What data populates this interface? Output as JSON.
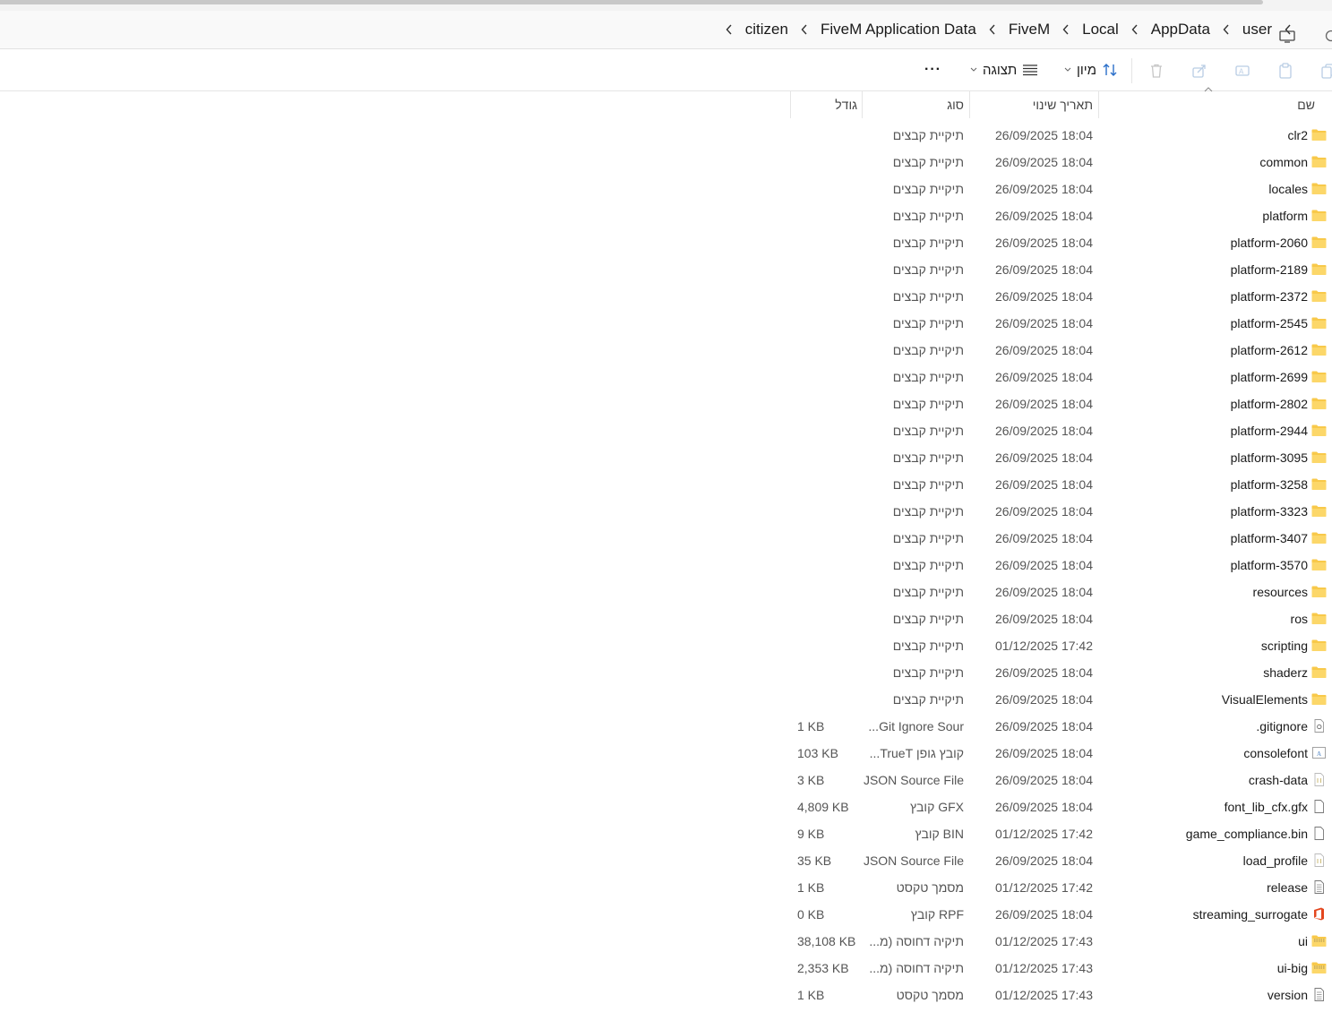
{
  "breadcrumb": [
    "user",
    "AppData",
    "Local",
    "FiveM",
    "FiveM Application Data",
    "citizen"
  ],
  "toolbar": {
    "sort_label": "מיון",
    "view_label": "תצוגה",
    "more_label": "···"
  },
  "columns": {
    "name": "שם",
    "date": "תאריך שינוי",
    "type": "סוג",
    "size": "גודל"
  },
  "files": [
    {
      "name": "clr2",
      "date": "26/09/2025 18:04",
      "type": "תיקיית קבצים",
      "size": "",
      "icon": "folder-icon"
    },
    {
      "name": "common",
      "date": "26/09/2025 18:04",
      "type": "תיקיית קבצים",
      "size": "",
      "icon": "folder-icon"
    },
    {
      "name": "locales",
      "date": "26/09/2025 18:04",
      "type": "תיקיית קבצים",
      "size": "",
      "icon": "folder-icon"
    },
    {
      "name": "platform",
      "date": "26/09/2025 18:04",
      "type": "תיקיית קבצים",
      "size": "",
      "icon": "folder-icon"
    },
    {
      "name": "platform-2060",
      "date": "26/09/2025 18:04",
      "type": "תיקיית קבצים",
      "size": "",
      "icon": "folder-icon"
    },
    {
      "name": "platform-2189",
      "date": "26/09/2025 18:04",
      "type": "תיקיית קבצים",
      "size": "",
      "icon": "folder-icon"
    },
    {
      "name": "platform-2372",
      "date": "26/09/2025 18:04",
      "type": "תיקיית קבצים",
      "size": "",
      "icon": "folder-icon"
    },
    {
      "name": "platform-2545",
      "date": "26/09/2025 18:04",
      "type": "תיקיית קבצים",
      "size": "",
      "icon": "folder-icon"
    },
    {
      "name": "platform-2612",
      "date": "26/09/2025 18:04",
      "type": "תיקיית קבצים",
      "size": "",
      "icon": "folder-icon"
    },
    {
      "name": "platform-2699",
      "date": "26/09/2025 18:04",
      "type": "תיקיית קבצים",
      "size": "",
      "icon": "folder-icon"
    },
    {
      "name": "platform-2802",
      "date": "26/09/2025 18:04",
      "type": "תיקיית קבצים",
      "size": "",
      "icon": "folder-icon"
    },
    {
      "name": "platform-2944",
      "date": "26/09/2025 18:04",
      "type": "תיקיית קבצים",
      "size": "",
      "icon": "folder-icon"
    },
    {
      "name": "platform-3095",
      "date": "26/09/2025 18:04",
      "type": "תיקיית קבצים",
      "size": "",
      "icon": "folder-icon"
    },
    {
      "name": "platform-3258",
      "date": "26/09/2025 18:04",
      "type": "תיקיית קבצים",
      "size": "",
      "icon": "folder-icon"
    },
    {
      "name": "platform-3323",
      "date": "26/09/2025 18:04",
      "type": "תיקיית קבצים",
      "size": "",
      "icon": "folder-icon"
    },
    {
      "name": "platform-3407",
      "date": "26/09/2025 18:04",
      "type": "תיקיית קבצים",
      "size": "",
      "icon": "folder-icon"
    },
    {
      "name": "platform-3570",
      "date": "26/09/2025 18:04",
      "type": "תיקיית קבצים",
      "size": "",
      "icon": "folder-icon"
    },
    {
      "name": "resources",
      "date": "26/09/2025 18:04",
      "type": "תיקיית קבצים",
      "size": "",
      "icon": "folder-icon"
    },
    {
      "name": "ros",
      "date": "26/09/2025 18:04",
      "type": "תיקיית קבצים",
      "size": "",
      "icon": "folder-icon"
    },
    {
      "name": "scripting",
      "date": "01/12/2025 17:42",
      "type": "תיקיית קבצים",
      "size": "",
      "icon": "folder-icon"
    },
    {
      "name": "shaderz",
      "date": "26/09/2025 18:04",
      "type": "תיקיית קבצים",
      "size": "",
      "icon": "folder-icon"
    },
    {
      "name": "VisualElements",
      "date": "26/09/2025 18:04",
      "type": "תיקיית קבצים",
      "size": "",
      "icon": "folder-icon"
    },
    {
      "name": ".gitignore",
      "date": "26/09/2025 18:04",
      "type": "Git Ignore Sour...",
      "size": "1 KB",
      "icon": "gitignore-file-icon"
    },
    {
      "name": "consolefont",
      "date": "26/09/2025 18:04",
      "type": "קובץ גופן TrueT...",
      "size": "103 KB",
      "icon": "font-file-icon"
    },
    {
      "name": "crash-data",
      "date": "26/09/2025 18:04",
      "type": "JSON Source File",
      "size": "3 KB",
      "icon": "json-file-icon"
    },
    {
      "name": "font_lib_cfx.gfx",
      "date": "26/09/2025 18:04",
      "type": "GFX קובץ",
      "size": "4,809 KB",
      "icon": "blank-file-icon"
    },
    {
      "name": "game_compliance.bin",
      "date": "01/12/2025 17:42",
      "type": "BIN קובץ",
      "size": "9 KB",
      "icon": "blank-file-icon"
    },
    {
      "name": "load_profile",
      "date": "26/09/2025 18:04",
      "type": "JSON Source File",
      "size": "35 KB",
      "icon": "json-file-icon"
    },
    {
      "name": "release",
      "date": "01/12/2025 17:42",
      "type": "מסמך טקסט",
      "size": "1 KB",
      "icon": "text-file-icon"
    },
    {
      "name": "streaming_surrogate",
      "date": "26/09/2025 18:04",
      "type": "RPF קובץ",
      "size": "0 KB",
      "icon": "office-file-icon"
    },
    {
      "name": "ui",
      "date": "01/12/2025 17:43",
      "type": "תיקיה דחוסה (מ...",
      "size": "38,108 KB",
      "icon": "zip-folder-icon"
    },
    {
      "name": "ui-big",
      "date": "01/12/2025 17:43",
      "type": "תיקיה דחוסה (מ...",
      "size": "2,353 KB",
      "icon": "zip-folder-icon"
    },
    {
      "name": "version",
      "date": "01/12/2025 17:43",
      "type": "מסמך טקסט",
      "size": "1 KB",
      "icon": "text-file-icon"
    }
  ]
}
